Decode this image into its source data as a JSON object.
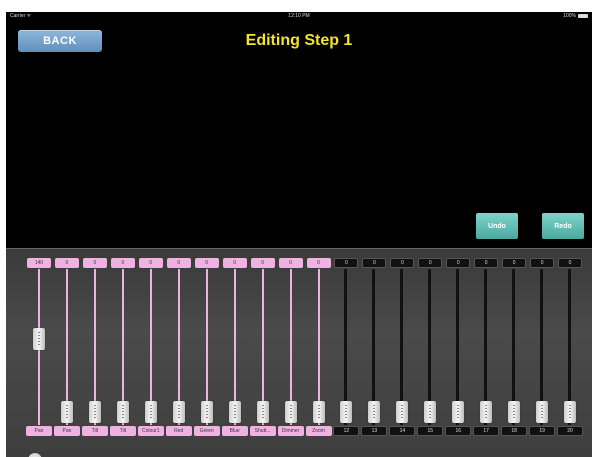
{
  "status_bar": {
    "carrier": "Carrier ᯤ",
    "time": "12:10 PM",
    "battery": "100%"
  },
  "header": {
    "back_label": "BACK",
    "title": "Editing Step 1"
  },
  "actions": {
    "undo_label": "Undo",
    "redo_label": "Redo"
  },
  "faders": [
    {
      "value": "140",
      "label": "Pan",
      "color": "pink",
      "level": 0.55
    },
    {
      "value": "0",
      "label": "Pan",
      "color": "pink",
      "level": 0
    },
    {
      "value": "0",
      "label": "Tilt",
      "color": "pink",
      "level": 0
    },
    {
      "value": "0",
      "label": "Tilt",
      "color": "pink",
      "level": 0
    },
    {
      "value": "0",
      "label": "Colour1",
      "color": "pink",
      "level": 0
    },
    {
      "value": "0",
      "label": "Red",
      "color": "pink",
      "level": 0
    },
    {
      "value": "0",
      "label": "Green",
      "color": "pink",
      "level": 0
    },
    {
      "value": "0",
      "label": "Blue",
      "color": "pink",
      "level": 0
    },
    {
      "value": "0",
      "label": "Shutt...",
      "color": "pink",
      "level": 0
    },
    {
      "value": "0",
      "label": "Dimmer",
      "color": "pink",
      "level": 0
    },
    {
      "value": "0",
      "label": "Zoom",
      "color": "pink",
      "level": 0
    },
    {
      "value": "0",
      "label": "12",
      "color": "dark",
      "level": 0
    },
    {
      "value": "0",
      "label": "13",
      "color": "dark",
      "level": 0
    },
    {
      "value": "0",
      "label": "14",
      "color": "dark",
      "level": 0
    },
    {
      "value": "0",
      "label": "15",
      "color": "dark",
      "level": 0
    },
    {
      "value": "0",
      "label": "16",
      "color": "dark",
      "level": 0
    },
    {
      "value": "0",
      "label": "17",
      "color": "dark",
      "level": 0
    },
    {
      "value": "0",
      "label": "18",
      "color": "dark",
      "level": 0
    },
    {
      "value": "0",
      "label": "19",
      "color": "dark",
      "level": 0
    },
    {
      "value": "0",
      "label": "20",
      "color": "dark",
      "level": 0
    }
  ],
  "colors": {
    "accent_title": "#f4e526",
    "fader_active": "#f0b2e3",
    "button_blue": "#6f9fcc",
    "button_teal": "#5fbfb4"
  }
}
